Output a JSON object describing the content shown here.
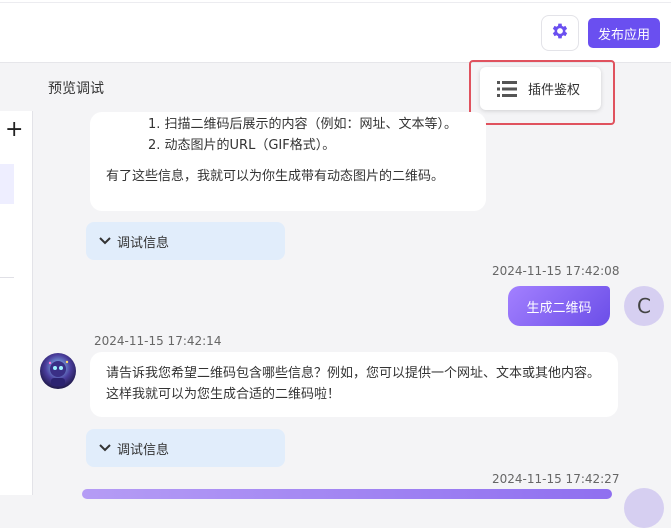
{
  "header": {
    "settings_icon": "gear-icon",
    "publish_label": "发布应用",
    "accent": "#6a4ff0"
  },
  "sidebar": {
    "add_icon": "plus-icon",
    "add_symbol": "+"
  },
  "preview": {
    "title": "预览调试",
    "plugin_auth_label": "插件鉴权",
    "plugin_auth_icon": "list-icon"
  },
  "chat": {
    "msg1": {
      "partial_line": "1. 扫描二维码后展示的内容（例如：网址、文本等）。",
      "line2": "2. 动态图片的URL（GIF格式）。",
      "line3": "有了这些信息，我就可以为你生成带有动态图片的二维码。"
    },
    "debug_label": "调试信息",
    "user1": {
      "timestamp": "2024-11-15 17:42:08",
      "text": "生成二维码",
      "avatar_letter": "C"
    },
    "bot2": {
      "timestamp": "2024-11-15 17:42:14",
      "text": "请告诉我您希望二维码包含哪些信息？例如，您可以提供一个网址、文本或其他内容。这样我就可以为您生成合适的二维码啦！"
    },
    "user2": {
      "timestamp": "2024-11-15 17:42:27"
    }
  }
}
